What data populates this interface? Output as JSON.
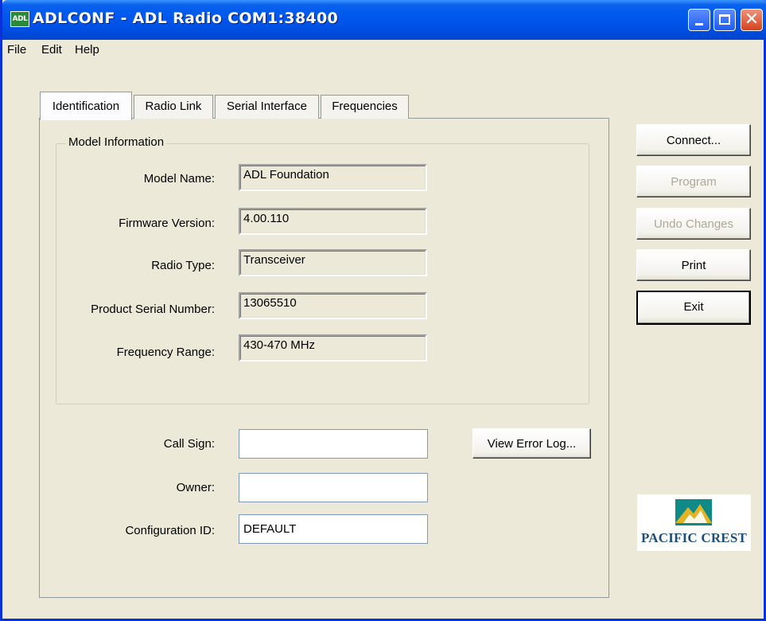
{
  "window": {
    "title": "ADLCONF - ADL Radio COM1:38400",
    "app_icon_text": "ADL"
  },
  "menu": {
    "items": [
      {
        "label": "File"
      },
      {
        "label": "Edit"
      },
      {
        "label": "Help"
      }
    ]
  },
  "tabs": [
    {
      "label": "Identification",
      "active": true
    },
    {
      "label": "Radio Link",
      "active": false
    },
    {
      "label": "Serial Interface",
      "active": false
    },
    {
      "label": "Frequencies",
      "active": false
    }
  ],
  "model_info": {
    "group_label": "Model Information",
    "fields": [
      {
        "label": "Model Name:",
        "value": "ADL Foundation"
      },
      {
        "label": "Firmware Version:",
        "value": "4.00.110"
      },
      {
        "label": "Radio Type:",
        "value": "Transceiver"
      },
      {
        "label": "Product Serial Number:",
        "value": "13065510"
      },
      {
        "label": "Frequency Range:",
        "value": "430-470 MHz"
      }
    ]
  },
  "editable": {
    "call_sign": {
      "label": "Call Sign:",
      "value": ""
    },
    "owner": {
      "label": "Owner:",
      "value": ""
    },
    "config_id": {
      "label": "Configuration ID:",
      "value": "DEFAULT"
    }
  },
  "buttons": {
    "view_error_log": "View Error Log...",
    "connect": "Connect...",
    "program": "Program",
    "undo": "Undo Changes",
    "print": "Print",
    "exit": "Exit"
  },
  "logo": {
    "text": "PACIFIC CREST",
    "colors": {
      "teal": "#0f8a86",
      "gold": "#e2b325",
      "navy": "#1d4f7a"
    }
  }
}
